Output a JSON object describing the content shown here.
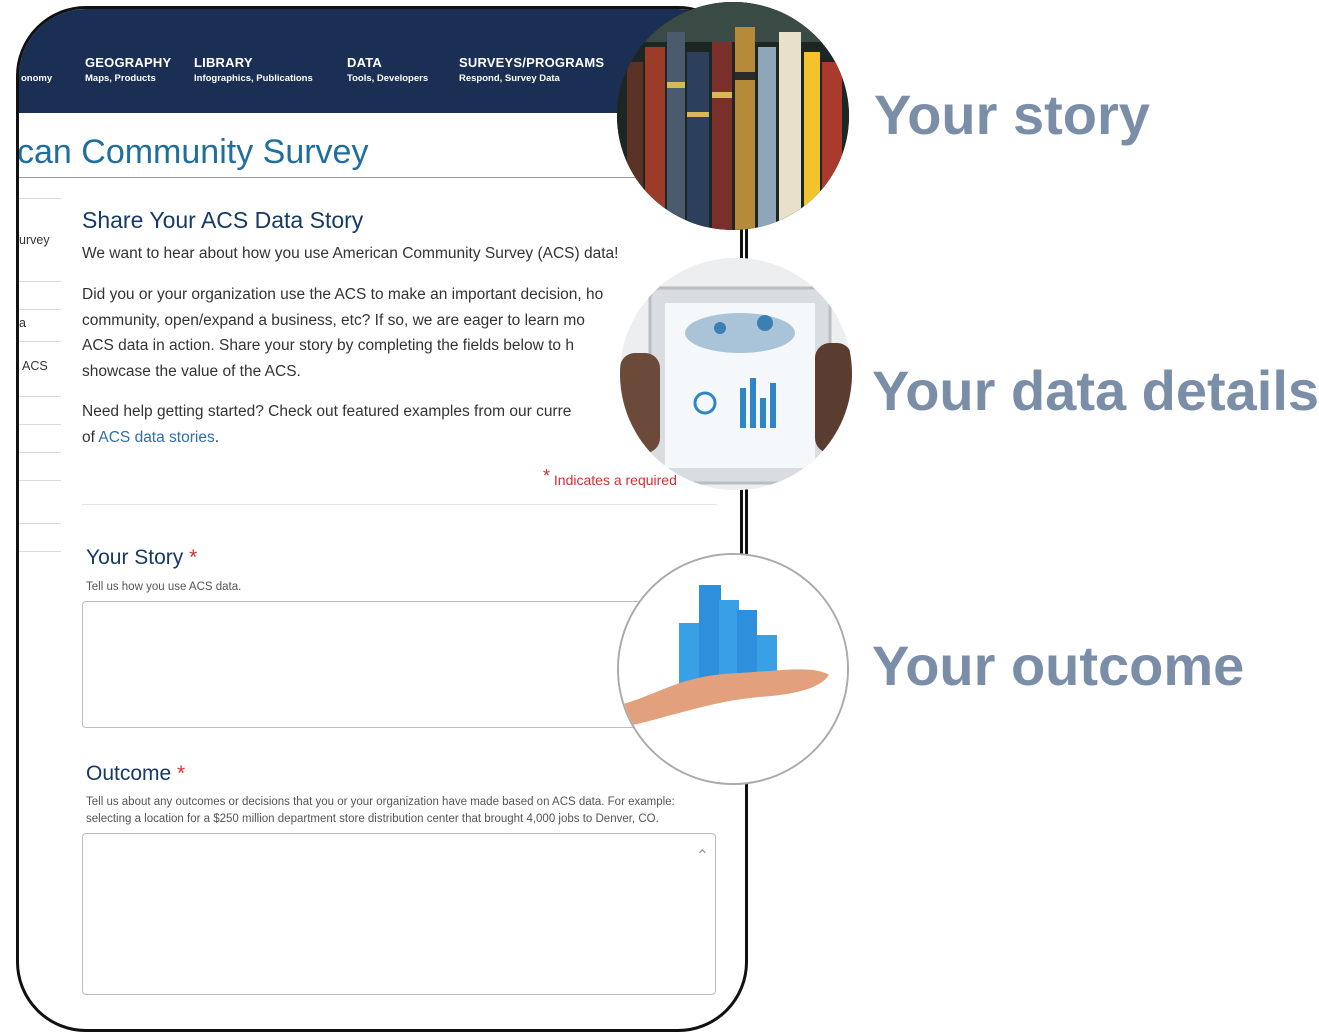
{
  "nav": {
    "partial_item": "onomy",
    "items": [
      {
        "title": "GEOGRAPHY",
        "sub": "Maps, Products"
      },
      {
        "title": "LIBRARY",
        "sub": "Infographics, Publications"
      },
      {
        "title": "DATA",
        "sub": "Tools, Developers"
      },
      {
        "title": "SURVEYS/PROGRAMS",
        "sub": "Respond, Survey Data"
      }
    ]
  },
  "page_title": "can Community Survey",
  "sidebar": [
    "urvey",
    "a",
    "ACS"
  ],
  "form": {
    "title": "Share Your ACS Data Story",
    "intro": "We want to hear about how you use American Community Survey (ACS) data!",
    "para2_lines": [
      "Did you or your organization use the ACS to make an important decision, ho",
      "community, open/expand a business, etc? If so, we are eager to learn mo",
      "ACS data in action. Share your story by completing the fields below to h",
      "showcase the value of the ACS."
    ],
    "para3_line1": "Need help getting started? Check out featured examples from our curre",
    "para3_prefix": "of ",
    "para3_link": "ACS data stories",
    "para3_suffix": ".",
    "required_star": "*",
    "required_text": "Indicates a required",
    "story_label": "Your Story",
    "story_help": "Tell us how you use ACS data.",
    "outcome_label": "Outcome",
    "outcome_help_lines": [
      "Tell us about any outcomes or decisions that you or your organization have made based on ACS data. For example:",
      "selecting a location for a $250 million department store distribution center that brought 4,000 jobs to Denver, CO."
    ]
  },
  "steps": [
    "Your story",
    "Your data details",
    "Your outcome"
  ],
  "colors": {
    "nav": "#1b2f54",
    "title": "#1f6e9e",
    "heading": "#7b8ea8",
    "required": "#d62f2f"
  },
  "icons": [
    "books-photo-icon",
    "tablet-data-photo-icon",
    "hand-chart-photo-icon",
    "chevron-up-icon"
  ]
}
